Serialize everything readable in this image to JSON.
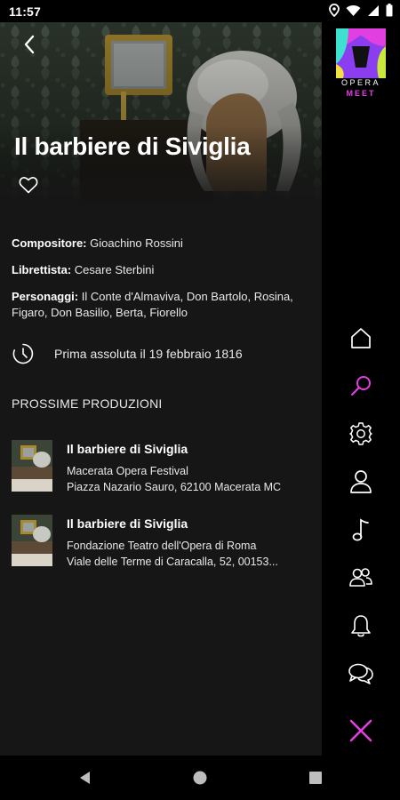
{
  "status_bar": {
    "time": "11:57"
  },
  "opera": {
    "title": "Il barbiere di Siviglia",
    "composer_label": "Compositore:",
    "composer": "Gioachino Rossini",
    "librettist_label": "Librettista:",
    "librettist": "Cesare Sterbini",
    "characters_label": "Personaggi:",
    "characters": "Il Conte d'Almaviva, Don Bartolo, Rosina, Figaro, Don Basilio, Berta, Fiorello",
    "premiere": "Prima assoluta il 19 febbraio 1816"
  },
  "productions": {
    "section_title": "PROSSIME PRODUZIONI",
    "items": [
      {
        "title": "Il barbiere di Siviglia",
        "venue": "Macerata Opera Festival",
        "address": "Piazza Nazario Sauro, 62100 Macerata MC"
      },
      {
        "title": "Il barbiere di Siviglia",
        "venue": "Fondazione Teatro dell'Opera di Roma",
        "address": "Viale delle Terme di Caracalla, 52, 00153..."
      }
    ]
  },
  "brand": {
    "line1": "OPERA",
    "line2": "MEET",
    "accent": "#e13fe0"
  },
  "sidebar": {
    "items": [
      "home-icon",
      "search-icon",
      "settings-icon",
      "profile-icon",
      "music-note-icon",
      "community-icon",
      "notifications-icon",
      "chat-icon",
      "close-icon"
    ],
    "active": "search-icon"
  }
}
